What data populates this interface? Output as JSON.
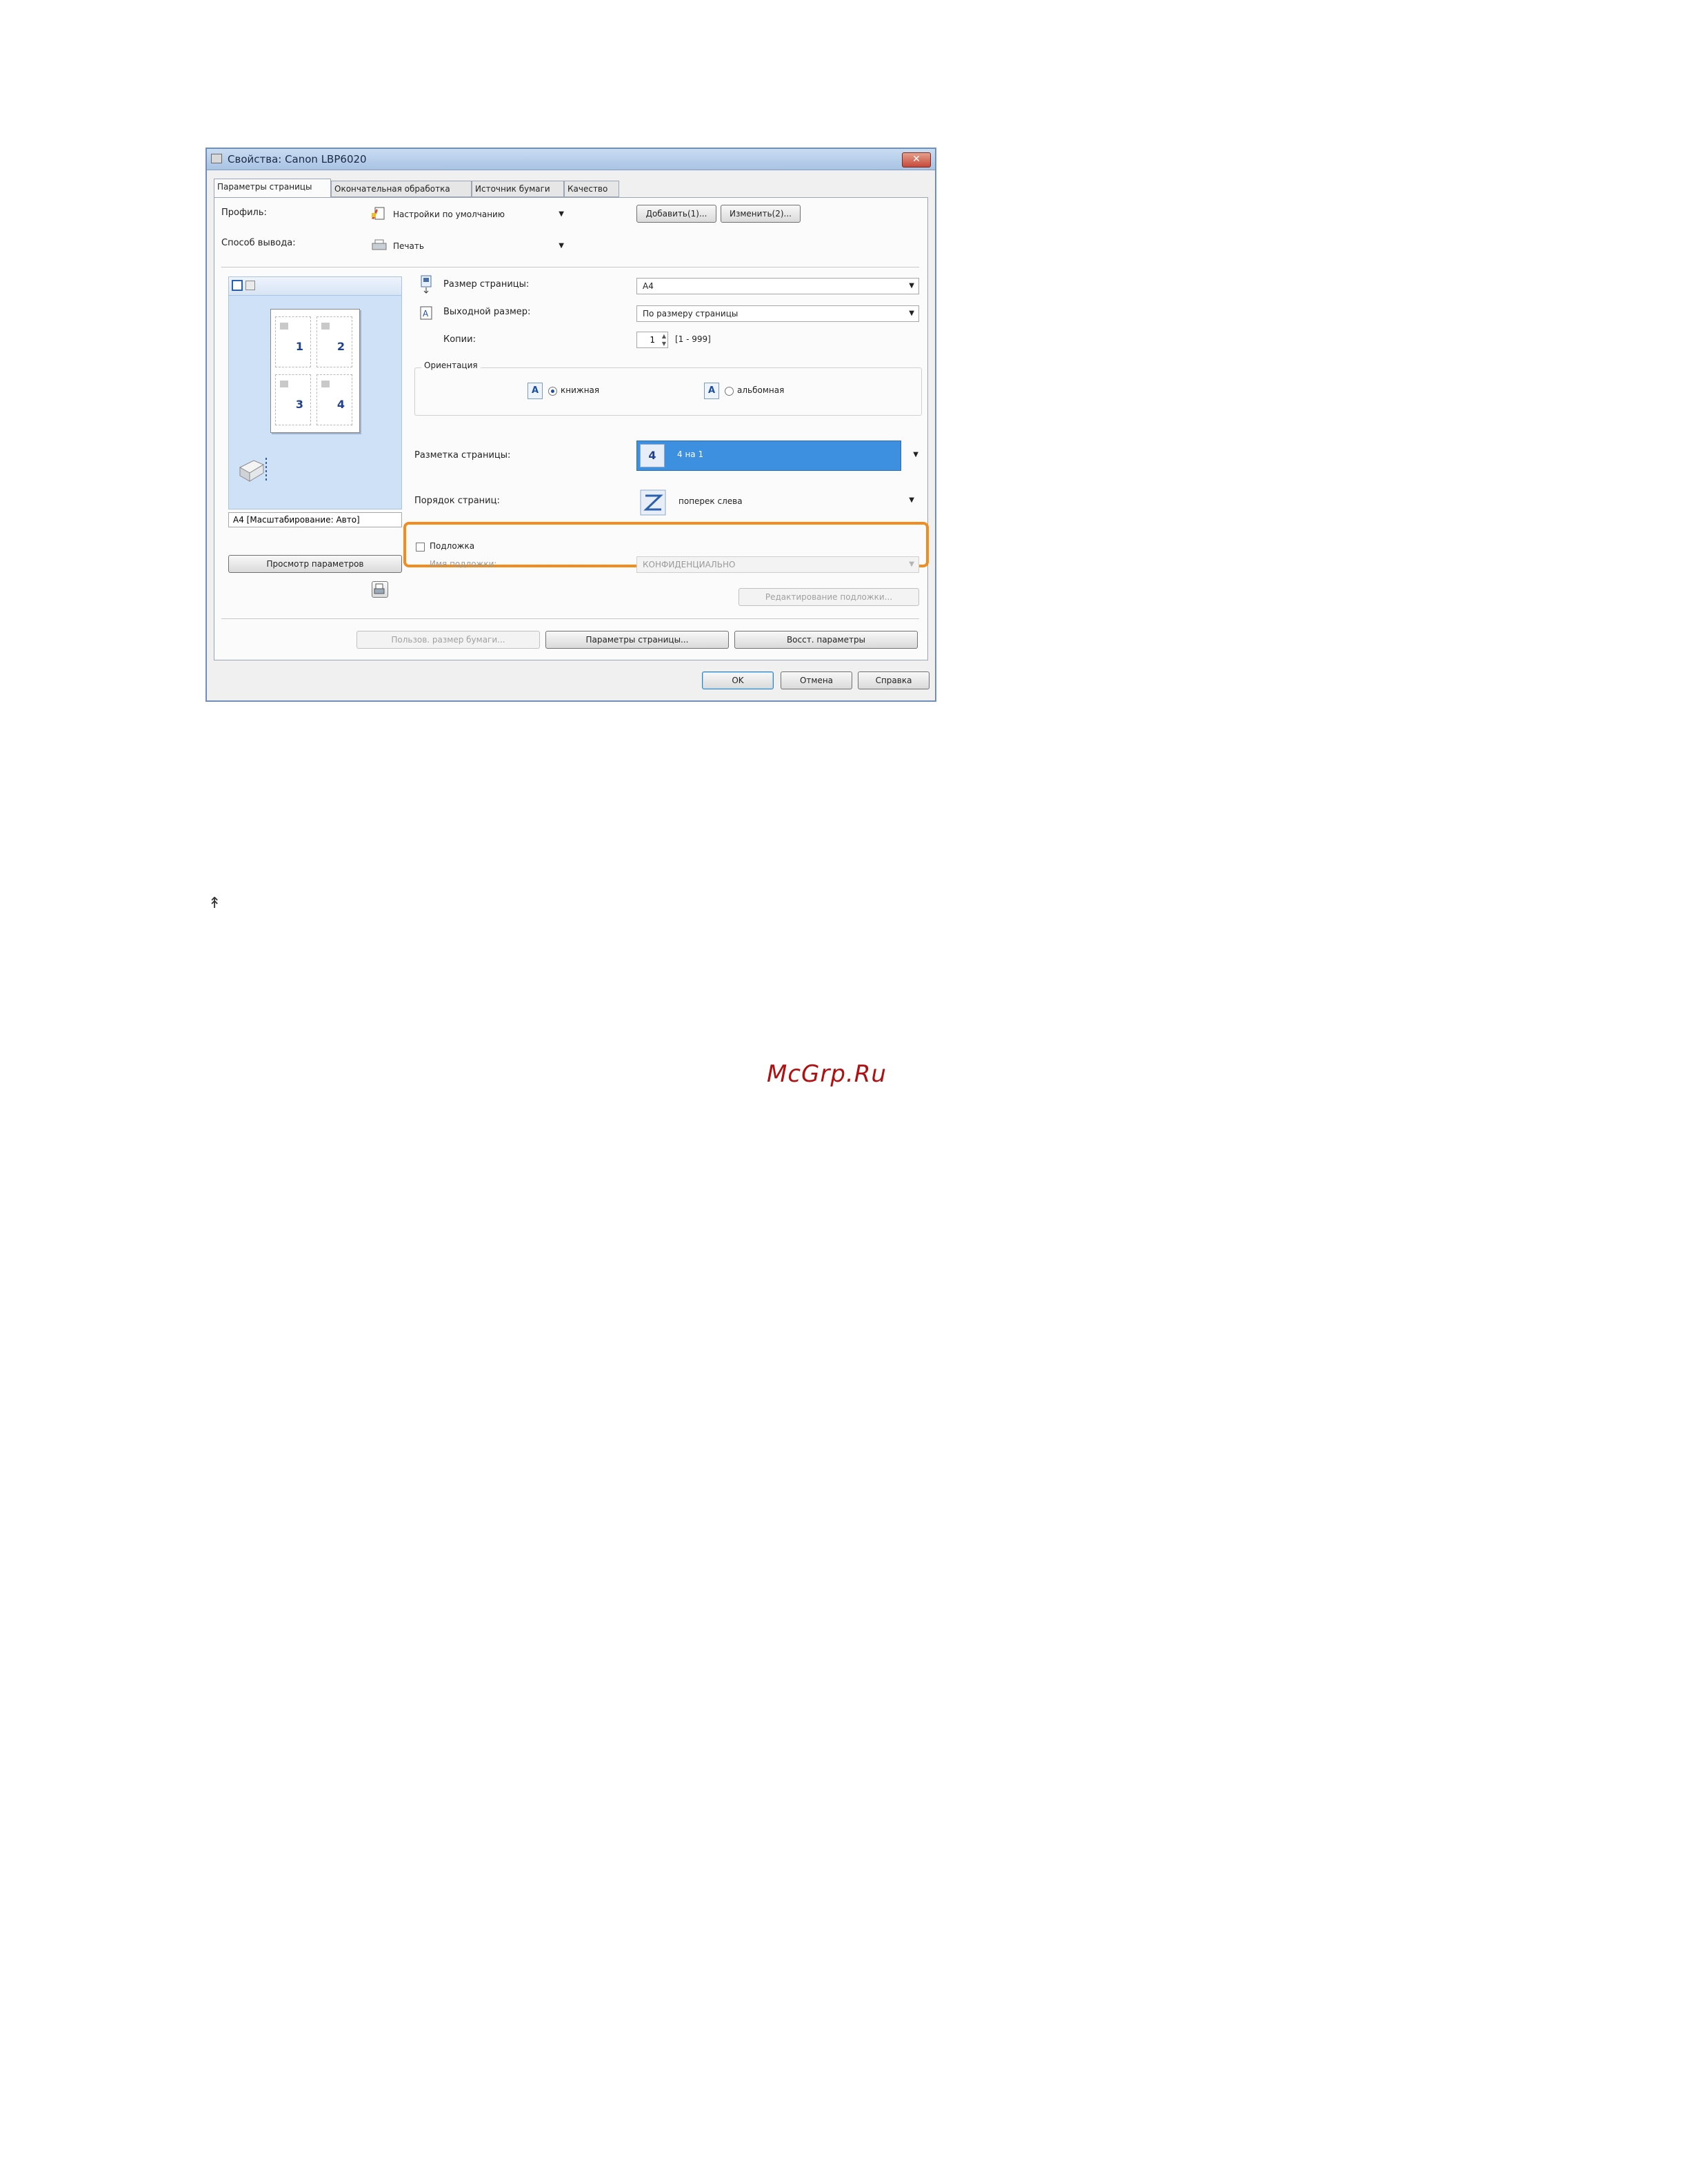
{
  "dialog": {
    "title": "Свойства: Canon LBP6020",
    "close_glyph": "✕",
    "tabs": [
      {
        "label": "Параметры страницы",
        "active": true
      },
      {
        "label": "Окончательная обработка",
        "active": false
      },
      {
        "label": "Источник бумаги",
        "active": false
      },
      {
        "label": "Качество",
        "active": false
      }
    ]
  },
  "profile": {
    "label": "Профиль:",
    "value": "Настройки по умолчанию",
    "add_button": "Добавить(1)...",
    "edit_button": "Изменить(2)..."
  },
  "output_method": {
    "label": "Способ вывода:",
    "value": "Печать"
  },
  "preview": {
    "pages": [
      "1",
      "2",
      "3",
      "4"
    ],
    "status_text": "A4 [Масштабирование: Авто]",
    "view_settings_button": "Просмотр параметров"
  },
  "page_size": {
    "label": "Размер страницы:",
    "value": "A4"
  },
  "output_size": {
    "label": "Выходной размер:",
    "value": "По размеру страницы"
  },
  "copies": {
    "label": "Копии:",
    "value": "1",
    "range": "[1 - 999]"
  },
  "orientation": {
    "label": "Ориентация",
    "portrait_label": "книжная",
    "landscape_label": "альбомная",
    "selected": "portrait",
    "icon_letter": "A"
  },
  "page_layout": {
    "label": "Разметка страницы:",
    "icon_number": "4",
    "value": "4 на 1"
  },
  "page_order": {
    "label": "Порядок страниц:",
    "value": "поперек слева"
  },
  "watermark": {
    "checkbox_label": "Подложка",
    "name_label": "Имя подложки:",
    "name_value": "КОНФИДЕНЦИАЛЬНО",
    "edit_button": "Редактирование подложки..."
  },
  "bottom_buttons": {
    "custom_size": "Пользов. размер бумаги...",
    "page_options": "Параметры страницы...",
    "restore": "Восст. параметры"
  },
  "footer_buttons": {
    "ok": "OK",
    "cancel": "Отмена",
    "help": "Справка"
  },
  "colors": {
    "highlight": "#f28c1c",
    "selection": "#3d8fe0",
    "watermark_text": "#b01010"
  },
  "page_mark": "↟",
  "site_watermark": "McGrp.Ru"
}
